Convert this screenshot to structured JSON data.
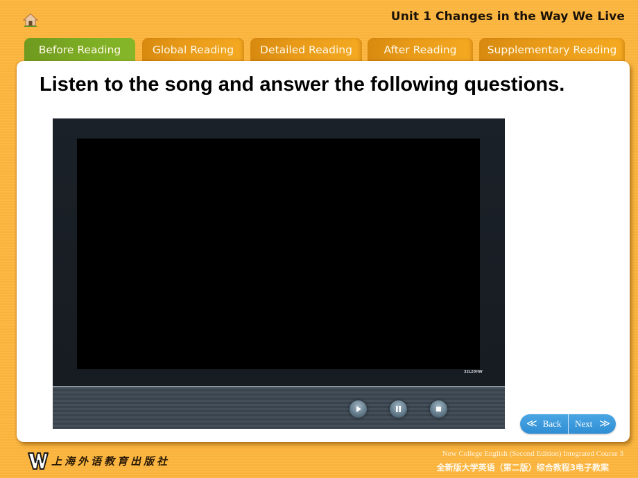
{
  "header": {
    "home_icon": "home-icon",
    "unit_title": "Unit 1 Changes in the Way We Live"
  },
  "tabs": [
    {
      "label": "Before Reading",
      "active": true
    },
    {
      "label": "Global Reading",
      "active": false
    },
    {
      "label": "Detailed Reading",
      "active": false
    },
    {
      "label": "After Reading",
      "active": false
    },
    {
      "label": "Supplementary Reading",
      "active": false
    }
  ],
  "main": {
    "headline": "Listen to the song and answer the following questions.",
    "video_player": {
      "model_label": "32L20HW",
      "controls": [
        {
          "name": "play",
          "icon": "play-icon"
        },
        {
          "name": "pause",
          "icon": "pause-icon"
        },
        {
          "name": "stop",
          "icon": "stop-icon"
        }
      ]
    }
  },
  "navigation": {
    "back_label": "Back",
    "back_icon": "double-chevron-left-icon",
    "next_label": "Next",
    "next_icon": "double-chevron-right-icon"
  },
  "footer": {
    "publisher_name": "上海外语教育出版社",
    "course_title_en": "New College English (Second Edition) Integrated Course 3",
    "course_title_cn": "全新版大学英语（第二版）综合教程3电子教案"
  },
  "colors": {
    "background": "#fbb845",
    "active_tab": "#7eae24",
    "inactive_tab": "#e89a18",
    "nav_button": "#2f8ed4"
  }
}
